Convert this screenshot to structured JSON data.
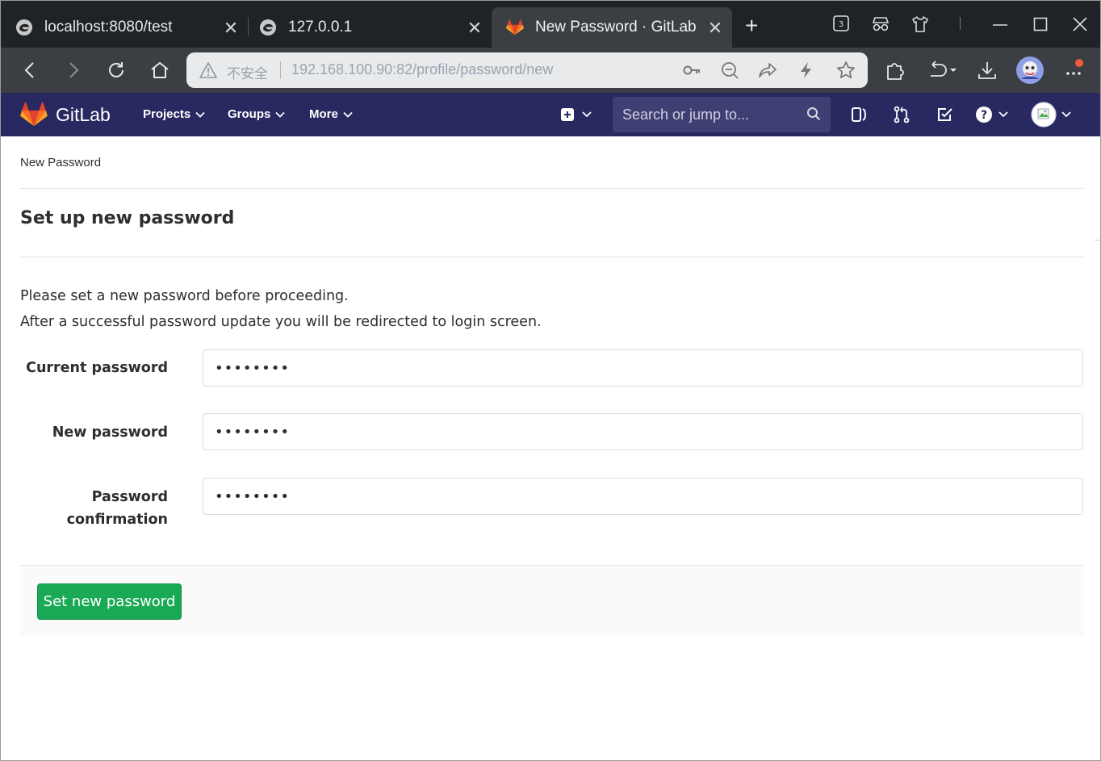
{
  "browser": {
    "tabs": [
      {
        "title": "localhost:8080/test",
        "favicon": "edge-icon",
        "active": false
      },
      {
        "title": "127.0.0.1",
        "favicon": "edge-icon",
        "active": false
      },
      {
        "title": "New Password · GitLab",
        "favicon": "gitlab-tanuki-icon",
        "active": true
      }
    ],
    "tab_count_badge": "3",
    "address": {
      "security_label": "不安全",
      "url": "192.168.100.90:82/profile/password/new"
    }
  },
  "gitlab": {
    "brand": "GitLab",
    "nav": {
      "projects": "Projects",
      "groups": "Groups",
      "more": "More"
    },
    "search": {
      "placeholder": "Search or jump to..."
    },
    "colors": {
      "header": "#292961",
      "primary_button": "#1aaa55"
    }
  },
  "page": {
    "breadcrumb": "New Password",
    "title": "Set up new password",
    "info_line_1": "Please set a new password before proceeding.",
    "info_line_2": "After a successful password update you will be redirected to login screen.",
    "fields": {
      "current_label": "Current password",
      "current_value": "••••••••",
      "new_label": "New password",
      "new_value": "••••••••",
      "confirm_label_1": "Password",
      "confirm_label_2": "confirmation",
      "confirm_value": "••••••••"
    },
    "submit_label": "Set new password"
  }
}
